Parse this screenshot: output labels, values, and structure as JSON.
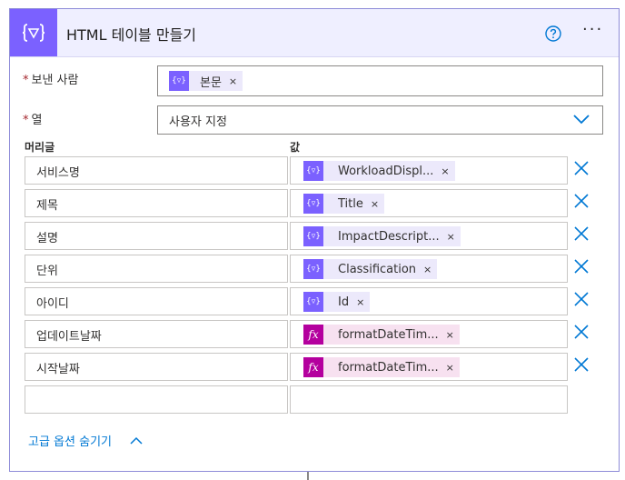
{
  "header": {
    "title": "HTML 테이블 만들기",
    "more": "···"
  },
  "from_field": {
    "required_mark": "*",
    "label": "보낸 사람",
    "token": {
      "label": "본문",
      "remove": "×"
    }
  },
  "columns_field": {
    "required_mark": "*",
    "label": "열",
    "value": "사용자 지정"
  },
  "table": {
    "header_label": "머리글",
    "value_label": "값",
    "rows": [
      {
        "key": "서비스명",
        "token": "WorkloadDispl...",
        "kind": "dynamic",
        "remove": "×"
      },
      {
        "key": "제목",
        "token": "Title",
        "kind": "dynamic",
        "remove": "×"
      },
      {
        "key": "설명",
        "token": "ImpactDescript...",
        "kind": "dynamic",
        "remove": "×"
      },
      {
        "key": "단위",
        "token": "Classification",
        "kind": "dynamic",
        "remove": "×"
      },
      {
        "key": "아이디",
        "token": "Id",
        "kind": "dynamic",
        "remove": "×"
      },
      {
        "key": "업데이트날짜",
        "token": "formatDateTim...",
        "kind": "expression",
        "remove": "×"
      },
      {
        "key": "시작날짜",
        "token": "formatDateTim...",
        "kind": "expression",
        "remove": "×"
      }
    ]
  },
  "advanced": {
    "label": "고급 옵션 숨기기"
  },
  "colors": {
    "accent": "#7b61ff",
    "expression": "#b4009e",
    "link": "#0078d4",
    "header_bg": "#efefff"
  }
}
